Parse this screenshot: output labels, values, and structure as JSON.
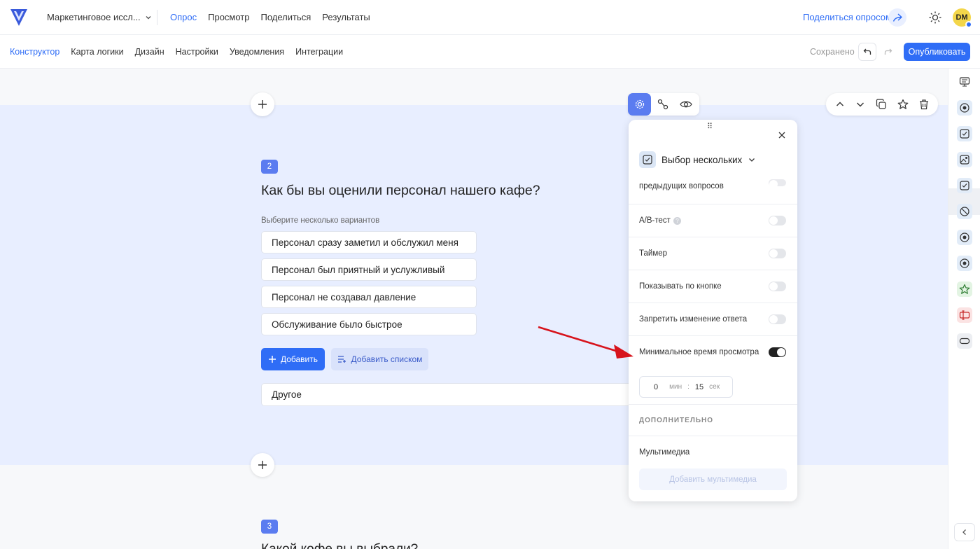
{
  "header": {
    "project_name": "Маркетинговое иссл...",
    "nav": [
      "Опрос",
      "Просмотр",
      "Поделиться",
      "Результаты"
    ],
    "share_label": "Поделиться опросом",
    "avatar_initials": "DM"
  },
  "subheader": {
    "tabs": [
      "Конструктор",
      "Карта логики",
      "Дизайн",
      "Настройки",
      "Уведомления",
      "Интеграции"
    ],
    "saved_label": "Сохранено",
    "publish_label": "Опубликовать"
  },
  "question": {
    "number": "2",
    "title": "Как бы вы оценили персонал нашего кафе?",
    "hint": "Выберите несколько вариантов",
    "options": [
      "Персонал сразу заметил и обслужил меня",
      "Персонал был приятный и услужливый",
      "Персонал не создавал давление",
      "Обслуживание было быстрое"
    ],
    "add_label": "Добавить",
    "add_list_label": "Добавить списком",
    "other_label": "Другое"
  },
  "next_question": {
    "number": "3",
    "title": "Какой кофе вы выбрали?"
  },
  "settings": {
    "type_label": "Выбор нескольких",
    "prev_questions_text": "предыдущих вопросов",
    "rows": [
      {
        "label": "A/B-тест",
        "on": false
      },
      {
        "label": "Таймер",
        "on": false
      },
      {
        "label": "Показывать по кнопке",
        "on": false
      },
      {
        "label": "Запретить изменение ответа",
        "on": false
      },
      {
        "label": "Минимальное время просмотра",
        "on": true
      }
    ],
    "time": {
      "min": "0",
      "min_unit": "мин",
      "sep": ":",
      "sec": "15",
      "sec_unit": "сек"
    },
    "extra_heading": "ДОПОЛНИТЕЛЬНО",
    "media_label": "Мультимедиа",
    "add_media_label": "Добавить мультимедиа"
  },
  "colors": {
    "accent": "#2f6df6",
    "band": "#e8eeff",
    "arrow": "#d7131c"
  },
  "icons": {
    "rail": [
      "monitor-icon",
      "radio-icon",
      "checkbox-icon",
      "image-choice-icon",
      "checkbox-icon",
      "no-eye-icon",
      "radio-icon",
      "radio-icon",
      "star-icon",
      "text-cursor-icon",
      "button-icon"
    ]
  }
}
